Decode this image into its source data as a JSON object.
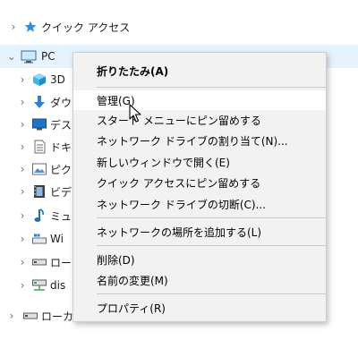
{
  "nav": {
    "quick_access": {
      "label": "クイック アクセス",
      "icon": "star-pin-icon"
    },
    "pc": {
      "label": "PC",
      "icon": "computer-icon"
    },
    "items": [
      {
        "label": "3D",
        "icon": "3d-objects-icon"
      },
      {
        "label": "ダウ",
        "icon": "download-arrow-icon"
      },
      {
        "label": "デス",
        "icon": "desktop-icon"
      },
      {
        "label": "ドキ",
        "icon": "document-icon"
      },
      {
        "label": "ピク",
        "icon": "pictures-icon"
      },
      {
        "label": "ビデ",
        "icon": "video-icon"
      },
      {
        "label": "ミュ",
        "icon": "music-note-icon"
      },
      {
        "label": "Wi",
        "icon": "windows-drive-icon"
      },
      {
        "label": "ロー",
        "icon": "local-drive-icon"
      },
      {
        "label": "dis",
        "icon": "network-drive-icon"
      }
    ],
    "bottom": {
      "label": "ローカ",
      "icon": "local-drive-icon"
    }
  },
  "context_menu": {
    "items": [
      {
        "label": "折りたたみ(A)",
        "bold": true
      },
      {
        "separator": true
      },
      {
        "label": "管理(G)",
        "hover": true
      },
      {
        "label": "スタート メニューにピン留めする"
      },
      {
        "label": "ネットワーク ドライブの割り当て(N)..."
      },
      {
        "label": "新しいウィンドウで開く(E)"
      },
      {
        "label": "クイック アクセスにピン留めする"
      },
      {
        "label": "ネットワーク ドライブの切断(C)..."
      },
      {
        "separator": true
      },
      {
        "label": "ネットワークの場所を追加する(L)"
      },
      {
        "separator": true
      },
      {
        "label": "削除(D)"
      },
      {
        "label": "名前の変更(M)"
      },
      {
        "separator": true
      },
      {
        "label": "プロパティ(R)"
      }
    ]
  },
  "colors": {
    "selected_row": "#e5f3ff",
    "menu_bg": "#f2f2f2",
    "accent": "#0078d7"
  }
}
